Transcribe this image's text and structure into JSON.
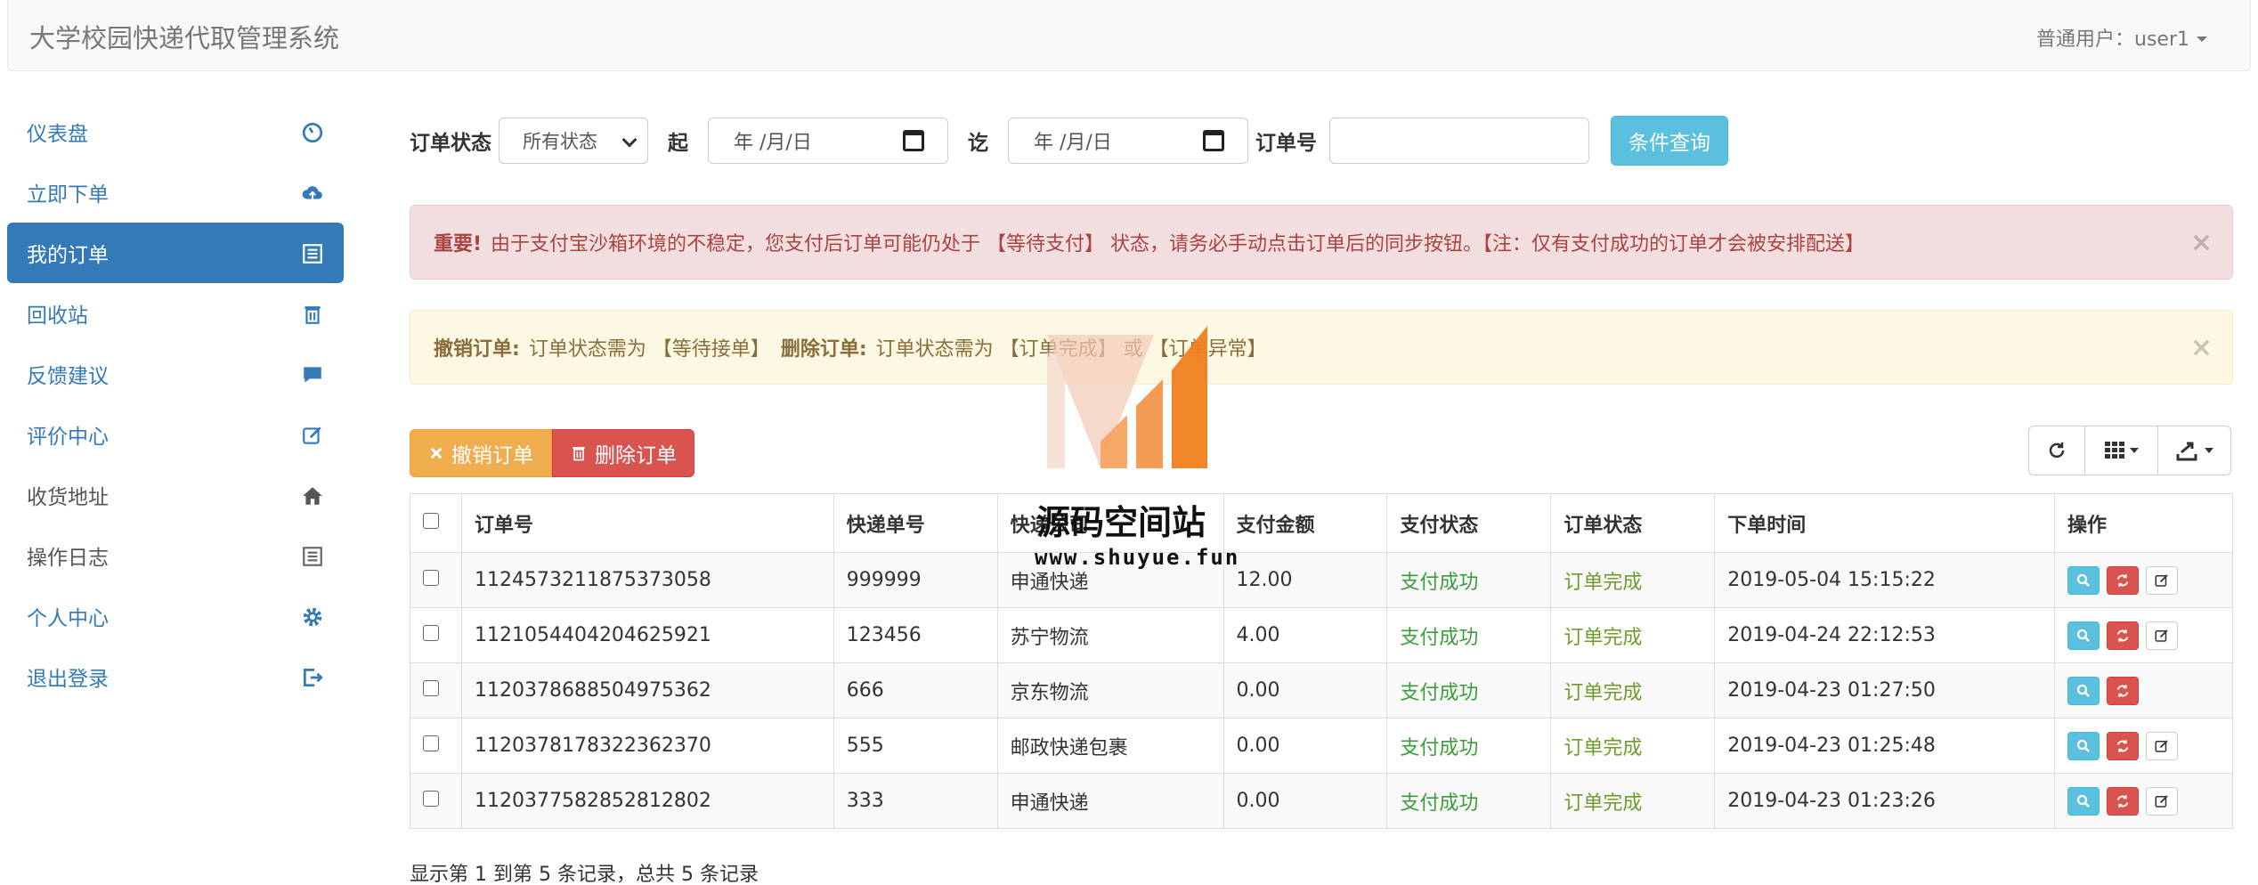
{
  "app": {
    "title": "大学校园快递代取管理系统",
    "user_label": "普通用户：user1"
  },
  "sidebar": {
    "items": [
      {
        "label": "仪表盘",
        "icon": "dashboard-icon"
      },
      {
        "label": "立即下单",
        "icon": "cloud-upload-icon"
      },
      {
        "label": "我的订单",
        "icon": "list-icon",
        "active": true
      },
      {
        "label": "回收站",
        "icon": "trash-icon"
      },
      {
        "label": "反馈建议",
        "icon": "comment-icon"
      },
      {
        "label": "评价中心",
        "icon": "edit-icon"
      },
      {
        "label": "收货地址",
        "icon": "home-icon"
      },
      {
        "label": "操作日志",
        "icon": "list-icon"
      },
      {
        "label": "个人中心",
        "icon": "gear-icon"
      },
      {
        "label": "退出登录",
        "icon": "logout-icon"
      }
    ]
  },
  "filter": {
    "status_label": "订单状态",
    "status_value": "所有状态",
    "from_label": "起",
    "from_placeholder": "年 /月/日",
    "to_label": "讫",
    "to_placeholder": "年 /月/日",
    "order_no_label": "订单号",
    "order_no_value": "",
    "query_button": "条件查询"
  },
  "alerts": {
    "danger": {
      "strong": "重要!",
      "text": "由于支付宝沙箱环境的不稳定，您支付后订单可能仍处于 【等待支付】 状态，请务必手动点击订单后的同步按钮。【注：仅有支付成功的订单才会被安排配送】",
      "close": "×"
    },
    "warning": {
      "strong1": "撤销订单:",
      "text1": "订单状态需为 【等待接单】",
      "strong2": "删除订单:",
      "text2": "订单状态需为 【订单完成】 或 【订单异常】",
      "close": "×"
    }
  },
  "toolbar": {
    "cancel_button": "撤销订单",
    "delete_button": "删除订单"
  },
  "table": {
    "headers": [
      "订单号",
      "快递单号",
      "快递公司",
      "支付金额",
      "支付状态",
      "订单状态",
      "下单时间",
      "操作"
    ],
    "rows": [
      {
        "order_no": "1124573211875373058",
        "tracking_no": "999999",
        "company": "申通快递",
        "amount": "12.00",
        "pay_status": "支付成功",
        "order_status": "订单完成",
        "time": "2019-05-04 15:15:22",
        "has_edit": true
      },
      {
        "order_no": "1121054404204625921",
        "tracking_no": "123456",
        "company": "苏宁物流",
        "amount": "4.00",
        "pay_status": "支付成功",
        "order_status": "订单完成",
        "time": "2019-04-24 22:12:53",
        "has_edit": true
      },
      {
        "order_no": "1120378688504975362",
        "tracking_no": "666",
        "company": "京东物流",
        "amount": "0.00",
        "pay_status": "支付成功",
        "order_status": "订单完成",
        "time": "2019-04-23 01:27:50",
        "has_edit": false
      },
      {
        "order_no": "1120378178322362370",
        "tracking_no": "555",
        "company": "邮政快递包裹",
        "amount": "0.00",
        "pay_status": "支付成功",
        "order_status": "订单完成",
        "time": "2019-04-23 01:25:48",
        "has_edit": true
      },
      {
        "order_no": "1120377582852812802",
        "tracking_no": "333",
        "company": "申通快递",
        "amount": "0.00",
        "pay_status": "支付成功",
        "order_status": "订单完成",
        "time": "2019-04-23 01:23:26",
        "has_edit": true
      }
    ]
  },
  "pagination": {
    "summary": "显示第 1 到第 5 条记录，总共 5 条记录"
  },
  "watermark": {
    "title": "源码空间站",
    "url": "www.shuyue.fun"
  },
  "colors": {
    "primary": "#337ab7",
    "info": "#5bc0de",
    "danger": "#d9534f",
    "warning": "#f0ad4e",
    "success_text": "#3c9c3c"
  }
}
